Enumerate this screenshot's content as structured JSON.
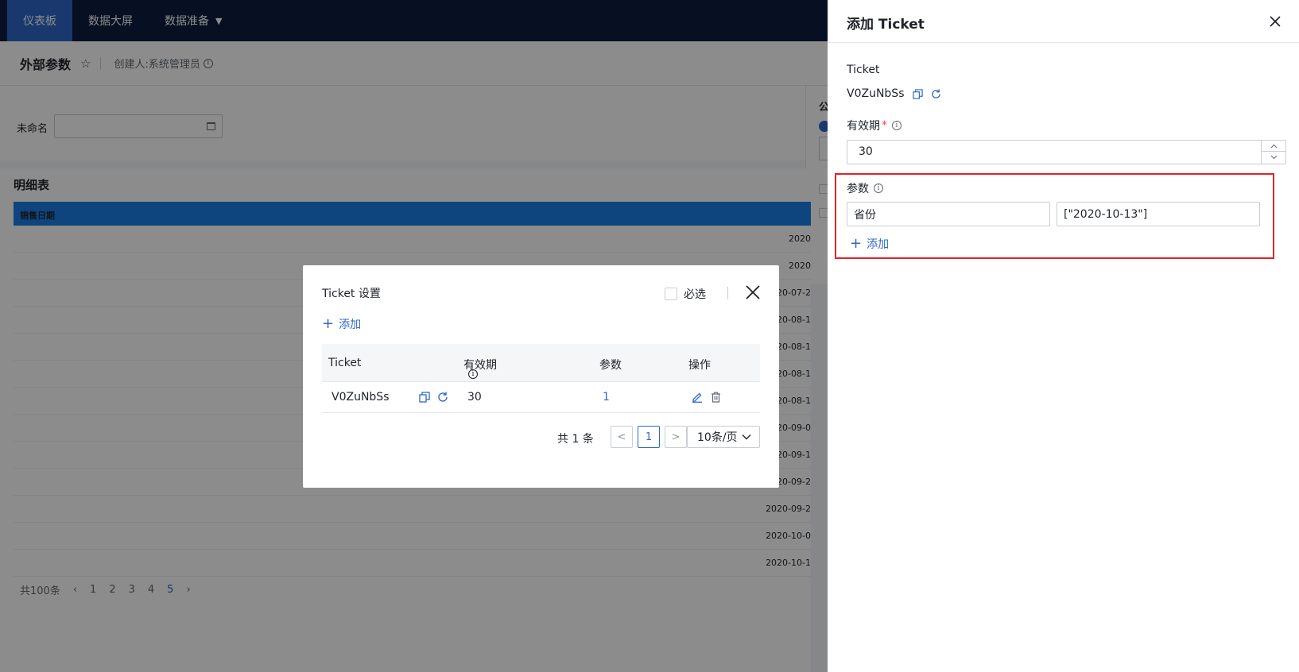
{
  "nav": {
    "items": [
      "仪表板",
      "数据大屏",
      "数据准备"
    ]
  },
  "header": {
    "title": "外部参数",
    "creator": "创建人:系统管理员"
  },
  "filter": {
    "label": "未命名",
    "value": ""
  },
  "side_panel": {
    "title": "公"
  },
  "detail": {
    "title": "明细表",
    "column": "销售日期",
    "dates": [
      "2020",
      "2020",
      "2020-07-2",
      "2020-08-1",
      "2020-08-1",
      "2020-08-1",
      "2020-08-1",
      "2020-09-0",
      "2020-09-1",
      "2020-09-2",
      "2020-09-2",
      "2020-10-0",
      "2020-10-1"
    ],
    "pager": {
      "total": "共100条",
      "pages": [
        "1",
        "2",
        "3",
        "4",
        "5"
      ],
      "current": "5"
    }
  },
  "modal": {
    "title": "Ticket 设置",
    "required_label": "必选",
    "add_label": "添加",
    "columns": {
      "ticket": "Ticket",
      "validity": "有效期",
      "params": "参数",
      "actions": "操作"
    },
    "rows": [
      {
        "ticket": "V0ZuNbSs",
        "validity": "30",
        "params": "1"
      }
    ],
    "pager": {
      "total": "共 1 条",
      "prev": "<",
      "page": "1",
      "next": ">",
      "size": "10条/页"
    }
  },
  "drawer": {
    "title": "添加 Ticket",
    "ticket_label": "Ticket",
    "ticket_value": "V0ZuNbSs",
    "validity_label": "有效期",
    "validity_value": "30",
    "params_label": "参数",
    "param_key": "省份",
    "param_value": "[\"2020-10-13\"]",
    "add_label": "添加"
  },
  "colors": {
    "accent": "#2f68c9",
    "nav_bg": "#0b1e3f",
    "highlight": "#e0242a",
    "table_header": "#1a7fe6"
  }
}
